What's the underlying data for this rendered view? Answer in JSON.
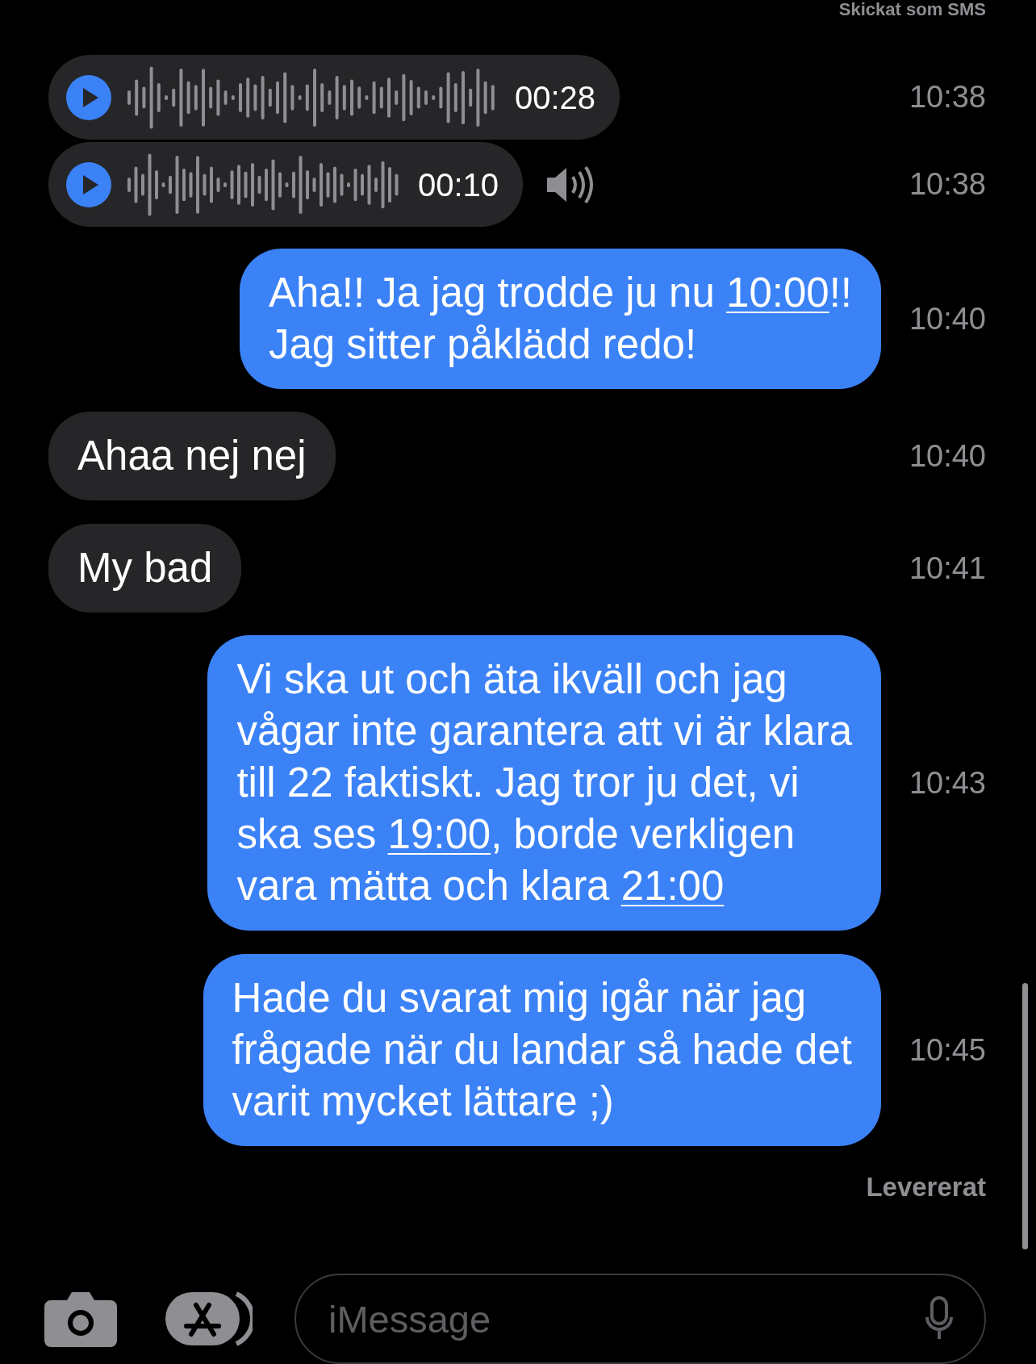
{
  "header_note": "Skickat som SMS",
  "messages": [
    {
      "kind": "audio",
      "sent": false,
      "duration": "00:28",
      "time": "10:38",
      "speaker": false
    },
    {
      "kind": "audio",
      "sent": false,
      "duration": "00:10",
      "time": "10:38",
      "speaker": true
    },
    {
      "kind": "text",
      "sent": true,
      "time": "10:40",
      "parts": [
        {
          "text": "Aha!! Ja jag trodde ju nu "
        },
        {
          "text": "10:00",
          "kind": "link"
        },
        {
          "text": "!!\nJag sitter påklädd redo!"
        }
      ]
    },
    {
      "kind": "text",
      "sent": false,
      "time": "10:40",
      "parts": [
        {
          "text": "Ahaa nej nej"
        }
      ]
    },
    {
      "kind": "text",
      "sent": false,
      "time": "10:41",
      "parts": [
        {
          "text": "My bad"
        }
      ]
    },
    {
      "kind": "text",
      "sent": true,
      "time": "10:43",
      "parts": [
        {
          "text": "Vi ska ut och äta ikväll och jag\nvågar inte garantera att vi är klara\ntill 22 faktiskt. Jag tror ju det, vi\nska ses "
        },
        {
          "text": "19:00",
          "kind": "link"
        },
        {
          "text": ", borde verkligen\nvara mätta och klara "
        },
        {
          "text": "21:00",
          "kind": "link"
        }
      ]
    },
    {
      "kind": "text",
      "sent": true,
      "time": "10:45",
      "parts": [
        {
          "text": "Hade du svarat mig igår när jag\nfrågade när du landar så hade det\nvarit mycket lättare ;)"
        }
      ]
    }
  ],
  "delivery_status": "Levererat",
  "composer": {
    "placeholder": "iMessage"
  }
}
